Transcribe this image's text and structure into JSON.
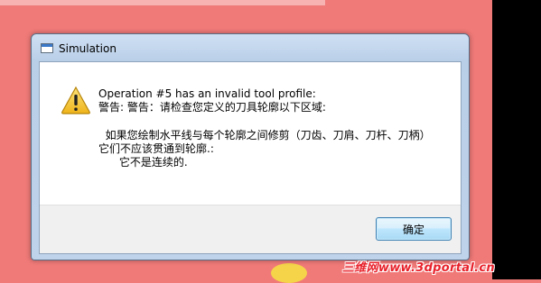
{
  "window": {
    "title": "Simulation",
    "icon": "window-icon"
  },
  "message": {
    "icon": "warning-icon",
    "line1": "Operation #5 has an invalid tool profile:",
    "line2": "警告: 警告：请检查您定义的刀具轮廓以下区域:",
    "line3": "  如果您绘制水平线与每个轮廓之间修剪（刀齿、刀肩、刀杆、刀柄）",
    "line4": "它们不应该贯通到轮廓.:",
    "line5": "      它不是连续的."
  },
  "buttons": {
    "ok_label": "确定"
  },
  "watermark": {
    "text": "三维网www.3dportal.cn"
  },
  "colors": {
    "background": "#f07a78",
    "accent": "#3c7fb1",
    "warning": "#f2c12e",
    "watermark": "#e8212b"
  }
}
